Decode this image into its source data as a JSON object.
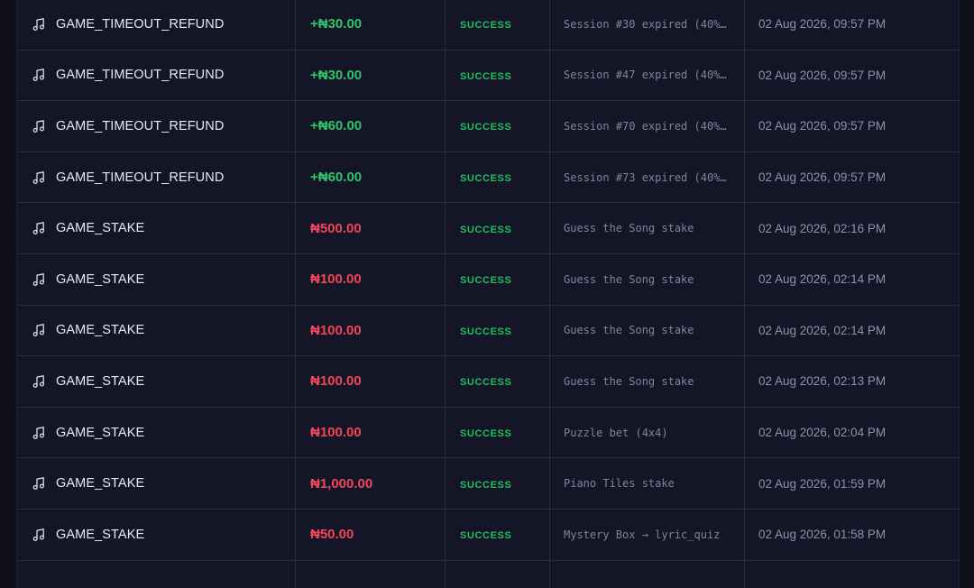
{
  "currency_symbol": "₦",
  "colors": {
    "positive": "#2fc46a",
    "negative": "#f0465a",
    "success": "#1fbf5f",
    "background": "#0e0f18",
    "row": "#141627"
  },
  "icon": "music-note-icon",
  "transactions": [
    {
      "type": "GAME_TIMEOUT_REFUND",
      "amount": "+₦30.00",
      "sign": "pos",
      "status": "SUCCESS",
      "description": "Session #30 expired (40%…",
      "date": "02 Aug 2026, 09:57 PM"
    },
    {
      "type": "GAME_TIMEOUT_REFUND",
      "amount": "+₦30.00",
      "sign": "pos",
      "status": "SUCCESS",
      "description": "Session #47 expired (40%…",
      "date": "02 Aug 2026, 09:57 PM"
    },
    {
      "type": "GAME_TIMEOUT_REFUND",
      "amount": "+₦60.00",
      "sign": "pos",
      "status": "SUCCESS",
      "description": "Session #70 expired (40%…",
      "date": "02 Aug 2026, 09:57 PM"
    },
    {
      "type": "GAME_TIMEOUT_REFUND",
      "amount": "+₦60.00",
      "sign": "pos",
      "status": "SUCCESS",
      "description": "Session #73 expired (40%…",
      "date": "02 Aug 2026, 09:57 PM"
    },
    {
      "type": "GAME_STAKE",
      "amount": "₦500.00",
      "sign": "neg",
      "status": "SUCCESS",
      "description": "Guess the Song stake",
      "date": "02 Aug 2026, 02:16 PM"
    },
    {
      "type": "GAME_STAKE",
      "amount": "₦100.00",
      "sign": "neg",
      "status": "SUCCESS",
      "description": "Guess the Song stake",
      "date": "02 Aug 2026, 02:14 PM"
    },
    {
      "type": "GAME_STAKE",
      "amount": "₦100.00",
      "sign": "neg",
      "status": "SUCCESS",
      "description": "Guess the Song stake",
      "date": "02 Aug 2026, 02:14 PM"
    },
    {
      "type": "GAME_STAKE",
      "amount": "₦100.00",
      "sign": "neg",
      "status": "SUCCESS",
      "description": "Guess the Song stake",
      "date": "02 Aug 2026, 02:13 PM"
    },
    {
      "type": "GAME_STAKE",
      "amount": "₦100.00",
      "sign": "neg",
      "status": "SUCCESS",
      "description": "Puzzle bet (4x4)",
      "date": "02 Aug 2026, 02:04 PM"
    },
    {
      "type": "GAME_STAKE",
      "amount": "₦1,000.00",
      "sign": "neg",
      "status": "SUCCESS",
      "description": "Piano Tiles stake",
      "date": "02 Aug 2026, 01:59 PM"
    },
    {
      "type": "GAME_STAKE",
      "amount": "₦50.00",
      "sign": "neg",
      "status": "SUCCESS",
      "description": "Mystery Box → lyric_quiz",
      "date": "02 Aug 2026, 01:58 PM"
    }
  ]
}
